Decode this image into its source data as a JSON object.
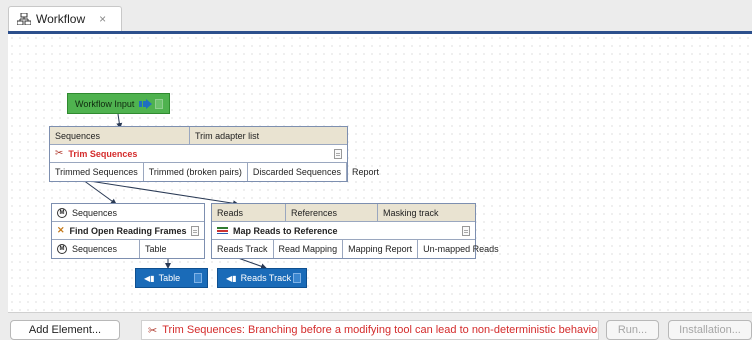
{
  "tab": {
    "title": "Workflow",
    "close": "×"
  },
  "workflow_input": {
    "label": "Workflow Input"
  },
  "trim_node": {
    "inputs": [
      "Sequences",
      "Trim adapter list"
    ],
    "title": "Trim Sequences",
    "outputs": [
      "Trimmed Sequences",
      "Trimmed (broken pairs)",
      "Discarded Sequences",
      "Report"
    ]
  },
  "orf_node": {
    "input": "Sequences",
    "title": "Find Open Reading Frames",
    "outputs": [
      "Sequences",
      "Table"
    ]
  },
  "map_node": {
    "inputs": [
      "Reads",
      "References",
      "Masking track"
    ],
    "title": "Map Reads to Reference",
    "outputs": [
      "Reads Track",
      "Read Mapping",
      "Mapping Report",
      "Un-mapped Reads"
    ]
  },
  "outputs": {
    "table": "Table",
    "reads_track": "Reads Track"
  },
  "bottom": {
    "add_element": "Add Element...",
    "warning": "Trim Sequences: Branching before a modifying tool can lead to non-deterministic behavior",
    "run": "Run...",
    "installation": "Installation..."
  },
  "colors": {
    "accent_blue": "#2c4f8c",
    "input_green": "#4fb24f",
    "output_blue": "#1a6bb8",
    "warning_red": "#d42c2c",
    "header_tan": "#e9e3d1"
  }
}
